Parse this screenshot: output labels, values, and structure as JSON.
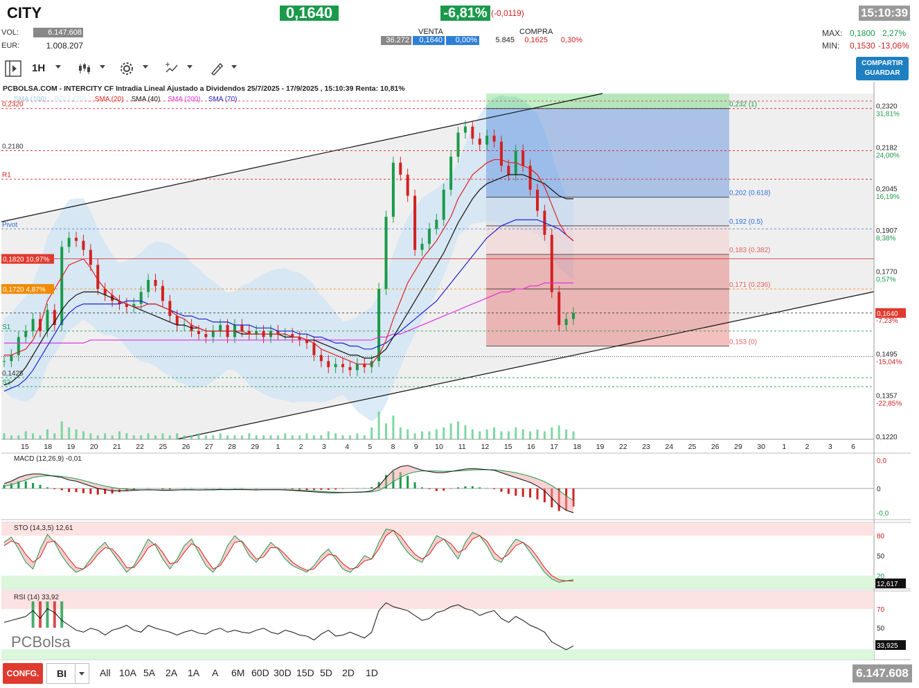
{
  "header": {
    "ticker": "CITY",
    "price": "0,1640",
    "change_pct": "-6,81%",
    "change_abs": "(-0,0119)",
    "time": "15:10:39",
    "vol_label": "VOL:",
    "vol_value": "6.147.608",
    "eur_label": "EUR:",
    "eur_value": "1.008.207",
    "venta_label": "VENTA",
    "compra_label": "COMPRA",
    "venta_qty": "36.272",
    "venta_price": "0,1640",
    "venta_pct": "0,00%",
    "compra_qty": "5.845",
    "compra_price": "0,1625",
    "compra_pct": "0,30%",
    "max_label": "MAX:",
    "max_value": "0,1800",
    "max_pct": "2,27%",
    "min_label": "MIN:",
    "min_value": "0,1530",
    "min_pct": "-13,06%"
  },
  "toolbar": {
    "interval": "1H",
    "share_label_1": "COMPARTIR",
    "share_label_2": "GUARDAR"
  },
  "colors": {
    "up": "#1a9a4a",
    "down": "#d32020",
    "sma20": "#e02020",
    "sma40": "#111111",
    "sma70": "#2020d0",
    "sma100": "#9cc8e8",
    "sma200": "#e030e0",
    "fib_blue": "#2f6fd6",
    "fib_red": "#e06060",
    "fib_green": "#2ecc40"
  },
  "chart_data": {
    "type": "line",
    "title": "PCBOLSA.COM - INTERCITY CF Intradia Lineal Ajustado a Dividendos 25/7/2025 - 17/9/2025 , 15:10:39 Renta: 10,81%",
    "legend": [
      "SMA (100)",
      "BOLL (20)",
      "SMA (20)",
      "SMA (40)",
      "SMA (200)",
      "SMA (70)"
    ],
    "x_ticks": [
      "15",
      "18",
      "19",
      "20",
      "21",
      "22",
      "25",
      "26",
      "27",
      "28",
      "29",
      "1",
      "2",
      "3",
      "4",
      "5",
      "8",
      "9",
      "10",
      "11",
      "12",
      "15",
      "16",
      "17",
      "18",
      "19",
      "22",
      "23",
      "24",
      "25",
      "26",
      "29",
      "30",
      "1",
      "2",
      "3",
      "6"
    ],
    "y_ticks": [
      "0,2320",
      "0,2182",
      "0,2045",
      "0,1907",
      "0,1770",
      "0,1632",
      "0,1495",
      "0,1357",
      "0,1220"
    ],
    "y_pct_labels": [
      "31,81%",
      "24,00%",
      "16,19%",
      "8,38%",
      "0,57%",
      "-7,23%",
      "-15,04%",
      "-22,85%"
    ],
    "ylim": [
      0.122,
      0.237
    ],
    "last_price_label": "0,1640",
    "left_levels": [
      {
        "name": "R2",
        "value": 0.232,
        "label": "0,2320"
      },
      {
        "name": "R1",
        "value": 0.218,
        "label": "0,2180"
      },
      {
        "name": "R1-line",
        "value": 0.2085,
        "label": "R1"
      },
      {
        "name": "Pivot",
        "value": 0.192,
        "label": "Pivot"
      },
      {
        "name": "close-prev",
        "value": 0.182,
        "label": "0,1820  10,97%"
      },
      {
        "name": "orange",
        "value": 0.172,
        "label": "0,1720  4,87%"
      },
      {
        "name": "S1",
        "value": 0.158,
        "label": "S1"
      },
      {
        "name": "S1-low",
        "value": 0.1425,
        "label": "0,1425"
      },
      {
        "name": "S2",
        "value": 0.1395,
        "label": "S2"
      }
    ],
    "fib_levels": [
      {
        "label": "0,232 (1)",
        "value": 0.232
      },
      {
        "label": "0,202 (0.618)",
        "value": 0.2025
      },
      {
        "label": "0,192 (0.5)",
        "value": 0.193
      },
      {
        "label": "0,183 (0.382)",
        "value": 0.1835
      },
      {
        "label": "0,171 (0.236)",
        "value": 0.172
      },
      {
        "label": "0,153 (0)",
        "value": 0.153
      }
    ],
    "price_series": [
      0.148,
      0.15,
      0.156,
      0.158,
      0.162,
      0.158,
      0.165,
      0.16,
      0.186,
      0.189,
      0.188,
      0.185,
      0.18,
      0.172,
      0.17,
      0.168,
      0.167,
      0.166,
      0.167,
      0.171,
      0.175,
      0.173,
      0.168,
      0.163,
      0.16,
      0.16,
      0.158,
      0.157,
      0.156,
      0.158,
      0.16,
      0.156,
      0.16,
      0.158,
      0.157,
      0.158,
      0.156,
      0.158,
      0.157,
      0.157,
      0.156,
      0.155,
      0.154,
      0.15,
      0.148,
      0.146,
      0.147,
      0.146,
      0.145,
      0.147,
      0.146,
      0.148,
      0.172,
      0.196,
      0.214,
      0.21,
      0.203,
      0.185,
      0.187,
      0.192,
      0.195,
      0.205,
      0.216,
      0.224,
      0.226,
      0.222,
      0.22,
      0.223,
      0.221,
      0.213,
      0.21,
      0.218,
      0.213,
      0.205,
      0.198,
      0.19,
      0.171,
      0.16,
      0.162,
      0.164
    ],
    "sma20": [
      0.15,
      0.15,
      0.151,
      0.152,
      0.155,
      0.16,
      0.168,
      0.172,
      0.176,
      0.18,
      0.181,
      0.182,
      0.179,
      0.175,
      0.172,
      0.17,
      0.168,
      0.167,
      0.166,
      0.166,
      0.167,
      0.167,
      0.166,
      0.165,
      0.163,
      0.162,
      0.16,
      0.159,
      0.158,
      0.158,
      0.158,
      0.158,
      0.158,
      0.158,
      0.157,
      0.157,
      0.157,
      0.157,
      0.157,
      0.157,
      0.156,
      0.156,
      0.155,
      0.154,
      0.152,
      0.151,
      0.15,
      0.149,
      0.148,
      0.147,
      0.147,
      0.147,
      0.15,
      0.155,
      0.162,
      0.168,
      0.174,
      0.178,
      0.182,
      0.185,
      0.188,
      0.192,
      0.196,
      0.202,
      0.206,
      0.21,
      0.212,
      0.214,
      0.215,
      0.215,
      0.214,
      0.214,
      0.213,
      0.212,
      0.21,
      0.206,
      0.2,
      0.194,
      0.19,
      0.188
    ],
    "sma40": [
      0.14,
      0.141,
      0.143,
      0.146,
      0.15,
      0.154,
      0.158,
      0.161,
      0.165,
      0.168,
      0.17,
      0.171,
      0.171,
      0.171,
      0.17,
      0.169,
      0.168,
      0.167,
      0.166,
      0.165,
      0.164,
      0.163,
      0.162,
      0.161,
      0.16,
      0.16,
      0.159,
      0.159,
      0.158,
      0.158,
      0.158,
      0.158,
      0.158,
      0.157,
      0.157,
      0.157,
      0.157,
      0.157,
      0.157,
      0.156,
      0.156,
      0.156,
      0.155,
      0.155,
      0.154,
      0.153,
      0.152,
      0.151,
      0.15,
      0.15,
      0.149,
      0.149,
      0.15,
      0.152,
      0.156,
      0.16,
      0.164,
      0.168,
      0.172,
      0.176,
      0.18,
      0.184,
      0.189,
      0.194,
      0.198,
      0.202,
      0.205,
      0.207,
      0.208,
      0.209,
      0.21,
      0.21,
      0.21,
      0.209,
      0.208,
      0.207,
      0.205,
      0.203,
      0.202,
      0.202
    ],
    "sma70": [
      0.138,
      0.139,
      0.14,
      0.142,
      0.145,
      0.149,
      0.153,
      0.157,
      0.161,
      0.164,
      0.166,
      0.167,
      0.167,
      0.167,
      0.167,
      0.167,
      0.167,
      0.168,
      0.168,
      0.168,
      0.167,
      0.167,
      0.166,
      0.165,
      0.164,
      0.163,
      0.163,
      0.162,
      0.162,
      0.161,
      0.161,
      0.161,
      0.16,
      0.16,
      0.16,
      0.159,
      0.159,
      0.159,
      0.158,
      0.158,
      0.158,
      0.157,
      0.157,
      0.156,
      0.156,
      0.155,
      0.154,
      0.154,
      0.153,
      0.153,
      0.152,
      0.152,
      0.153,
      0.154,
      0.156,
      0.158,
      0.16,
      0.162,
      0.164,
      0.166,
      0.168,
      0.171,
      0.174,
      0.177,
      0.18,
      0.183,
      0.186,
      0.189,
      0.191,
      0.193,
      0.194,
      0.195,
      0.195,
      0.195,
      0.195,
      0.194,
      0.193,
      0.192,
      0.19,
      0.188
    ],
    "sma200": [
      0.154,
      0.154,
      0.154,
      0.154,
      0.154,
      0.154,
      0.154,
      0.154,
      0.154,
      0.154,
      0.154,
      0.154,
      0.155,
      0.155,
      0.155,
      0.155,
      0.155,
      0.155,
      0.155,
      0.155,
      0.155,
      0.155,
      0.155,
      0.155,
      0.155,
      0.155,
      0.155,
      0.155,
      0.155,
      0.155,
      0.155,
      0.155,
      0.155,
      0.155,
      0.155,
      0.155,
      0.155,
      0.155,
      0.155,
      0.155,
      0.155,
      0.155,
      0.155,
      0.155,
      0.155,
      0.155,
      0.155,
      0.155,
      0.155,
      0.155,
      0.155,
      0.155,
      0.156,
      0.156,
      0.157,
      0.157,
      0.158,
      0.159,
      0.16,
      0.161,
      0.162,
      0.163,
      0.164,
      0.165,
      0.166,
      0.167,
      0.168,
      0.169,
      0.17,
      0.171,
      0.171,
      0.172,
      0.172,
      0.173,
      0.173,
      0.174,
      0.174,
      0.174,
      0.174,
      0.174
    ],
    "volume": [
      3,
      2,
      2,
      4,
      3,
      2,
      5,
      3,
      9,
      6,
      5,
      4,
      3,
      2,
      3,
      2,
      4,
      3,
      2,
      2,
      3,
      2,
      3,
      2,
      3,
      2,
      2,
      3,
      2,
      2,
      3,
      2,
      2,
      2,
      3,
      2,
      2,
      2,
      2,
      3,
      2,
      2,
      3,
      2,
      2,
      4,
      3,
      2,
      2,
      3,
      2,
      6,
      14,
      8,
      12,
      6,
      5,
      3,
      4,
      4,
      5,
      6,
      8,
      9,
      7,
      5,
      4,
      5,
      6,
      4,
      4,
      6,
      5,
      4,
      5,
      4,
      6,
      7,
      5,
      4
    ],
    "macd": {
      "label": "MACD (12,26,9)",
      "value": "-0,01",
      "ticks": [
        "0,0",
        "0",
        "-0,0"
      ],
      "line": [
        0.2,
        0.3,
        0.45,
        0.55,
        0.6,
        0.6,
        0.55,
        0.5,
        0.45,
        0.35,
        0.3,
        0.2,
        0.1,
        0.0,
        -0.05,
        -0.1,
        -0.1,
        -0.1,
        -0.08,
        -0.06,
        -0.05,
        -0.06,
        -0.08,
        -0.08,
        -0.06,
        -0.05,
        -0.05,
        -0.06,
        -0.05,
        -0.05,
        -0.04,
        -0.05,
        -0.04,
        -0.04,
        -0.05,
        -0.06,
        -0.05,
        -0.05,
        -0.05,
        -0.06,
        -0.08,
        -0.1,
        -0.12,
        -0.14,
        -0.16,
        -0.18,
        -0.18,
        -0.17,
        -0.16,
        -0.15,
        -0.14,
        -0.1,
        0.1,
        0.45,
        0.75,
        0.9,
        0.95,
        0.85,
        0.75,
        0.7,
        0.65,
        0.65,
        0.7,
        0.75,
        0.8,
        0.82,
        0.8,
        0.78,
        0.75,
        0.65,
        0.55,
        0.45,
        0.35,
        0.25,
        0.1,
        -0.1,
        -0.4,
        -0.7,
        -0.9,
        -1.0
      ],
      "signal": [
        0.1,
        0.15,
        0.25,
        0.35,
        0.45,
        0.5,
        0.52,
        0.52,
        0.5,
        0.45,
        0.4,
        0.33,
        0.25,
        0.17,
        0.1,
        0.04,
        0.0,
        -0.03,
        -0.05,
        -0.06,
        -0.06,
        -0.06,
        -0.06,
        -0.06,
        -0.06,
        -0.06,
        -0.06,
        -0.06,
        -0.06,
        -0.06,
        -0.05,
        -0.05,
        -0.05,
        -0.05,
        -0.05,
        -0.05,
        -0.05,
        -0.05,
        -0.05,
        -0.05,
        -0.06,
        -0.07,
        -0.08,
        -0.1,
        -0.12,
        -0.14,
        -0.15,
        -0.16,
        -0.16,
        -0.16,
        -0.15,
        -0.14,
        -0.08,
        0.08,
        0.28,
        0.45,
        0.6,
        0.68,
        0.72,
        0.72,
        0.72,
        0.71,
        0.71,
        0.72,
        0.74,
        0.76,
        0.77,
        0.77,
        0.77,
        0.74,
        0.7,
        0.65,
        0.58,
        0.5,
        0.4,
        0.28,
        0.12,
        -0.08,
        -0.3,
        -0.5
      ]
    },
    "sto": {
      "label": "STO (14,3,5)",
      "value": "12,61",
      "last_label": "12,617",
      "ticks": [
        "80",
        "50",
        "20"
      ],
      "k": [
        70,
        78,
        60,
        40,
        30,
        60,
        82,
        70,
        50,
        35,
        25,
        30,
        45,
        60,
        70,
        55,
        40,
        25,
        35,
        55,
        75,
        65,
        45,
        30,
        45,
        65,
        75,
        55,
        35,
        25,
        40,
        65,
        80,
        70,
        50,
        40,
        55,
        70,
        60,
        45,
        35,
        30,
        25,
        35,
        50,
        60,
        45,
        30,
        25,
        35,
        50,
        45,
        70,
        90,
        88,
        70,
        55,
        45,
        40,
        60,
        80,
        75,
        60,
        45,
        70,
        85,
        80,
        65,
        45,
        40,
        60,
        75,
        70,
        55,
        40,
        25,
        15,
        10,
        12,
        14
      ],
      "d": [
        65,
        72,
        68,
        52,
        40,
        48,
        70,
        72,
        60,
        45,
        32,
        30,
        38,
        52,
        62,
        60,
        48,
        32,
        32,
        45,
        62,
        68,
        55,
        38,
        40,
        55,
        68,
        62,
        45,
        30,
        35,
        52,
        70,
        72,
        58,
        45,
        48,
        62,
        62,
        52,
        40,
        33,
        28,
        30,
        42,
        52,
        50,
        38,
        30,
        32,
        42,
        45,
        60,
        80,
        88,
        80,
        65,
        52,
        45,
        52,
        68,
        75,
        68,
        55,
        60,
        75,
        80,
        72,
        55,
        45,
        52,
        65,
        70,
        62,
        48,
        32,
        20,
        14,
        12,
        12
      ]
    },
    "rsi": {
      "label": "RSI (14)",
      "value": "33,92",
      "last_label": "33,925",
      "ticks": [
        "70",
        "50"
      ],
      "values": [
        58,
        60,
        62,
        64,
        70,
        62,
        72,
        68,
        60,
        55,
        50,
        48,
        52,
        50,
        45,
        50,
        52,
        55,
        50,
        48,
        55,
        52,
        50,
        48,
        45,
        48,
        50,
        47,
        46,
        50,
        52,
        48,
        50,
        48,
        47,
        50,
        52,
        48,
        46,
        50,
        48,
        45,
        44,
        40,
        46,
        50,
        44,
        45,
        48,
        45,
        42,
        48,
        70,
        78,
        74,
        72,
        70,
        65,
        60,
        62,
        68,
        70,
        74,
        76,
        72,
        70,
        65,
        68,
        70,
        62,
        58,
        64,
        60,
        55,
        52,
        48,
        38,
        34,
        30,
        34
      ]
    },
    "ind_x_ticks": [
      "0,0",
      "0",
      "-0,0"
    ],
    "watermark": "PCBolsa"
  },
  "bottom": {
    "config_label": "CONFG.",
    "mode_label": "BI",
    "periods": [
      "All",
      "10A",
      "5A",
      "2A",
      "1A",
      "A",
      "6M",
      "60D",
      "30D",
      "15D",
      "5D",
      "2D",
      "1D"
    ],
    "total_volume": "6.147.608"
  }
}
